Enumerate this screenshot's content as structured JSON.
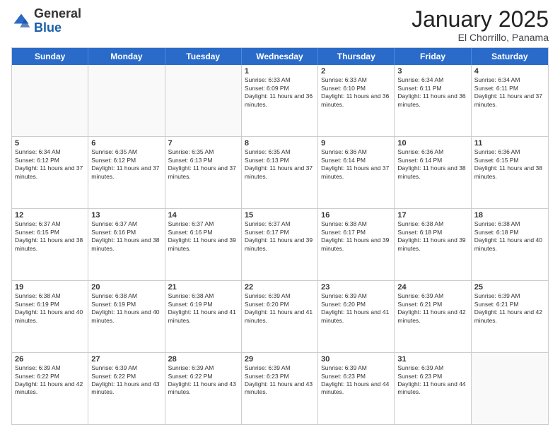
{
  "header": {
    "logo_general": "General",
    "logo_blue": "Blue",
    "month_title": "January 2025",
    "subtitle": "El Chorrillo, Panama"
  },
  "days_of_week": [
    "Sunday",
    "Monday",
    "Tuesday",
    "Wednesday",
    "Thursday",
    "Friday",
    "Saturday"
  ],
  "rows": [
    [
      {
        "day": "",
        "text": "",
        "empty": true
      },
      {
        "day": "",
        "text": "",
        "empty": true
      },
      {
        "day": "",
        "text": "",
        "empty": true
      },
      {
        "day": "1",
        "text": "Sunrise: 6:33 AM\nSunset: 6:09 PM\nDaylight: 11 hours and 36 minutes.",
        "empty": false
      },
      {
        "day": "2",
        "text": "Sunrise: 6:33 AM\nSunset: 6:10 PM\nDaylight: 11 hours and 36 minutes.",
        "empty": false
      },
      {
        "day": "3",
        "text": "Sunrise: 6:34 AM\nSunset: 6:11 PM\nDaylight: 11 hours and 36 minutes.",
        "empty": false
      },
      {
        "day": "4",
        "text": "Sunrise: 6:34 AM\nSunset: 6:11 PM\nDaylight: 11 hours and 37 minutes.",
        "empty": false
      }
    ],
    [
      {
        "day": "5",
        "text": "Sunrise: 6:34 AM\nSunset: 6:12 PM\nDaylight: 11 hours and 37 minutes.",
        "empty": false
      },
      {
        "day": "6",
        "text": "Sunrise: 6:35 AM\nSunset: 6:12 PM\nDaylight: 11 hours and 37 minutes.",
        "empty": false
      },
      {
        "day": "7",
        "text": "Sunrise: 6:35 AM\nSunset: 6:13 PM\nDaylight: 11 hours and 37 minutes.",
        "empty": false
      },
      {
        "day": "8",
        "text": "Sunrise: 6:35 AM\nSunset: 6:13 PM\nDaylight: 11 hours and 37 minutes.",
        "empty": false
      },
      {
        "day": "9",
        "text": "Sunrise: 6:36 AM\nSunset: 6:14 PM\nDaylight: 11 hours and 37 minutes.",
        "empty": false
      },
      {
        "day": "10",
        "text": "Sunrise: 6:36 AM\nSunset: 6:14 PM\nDaylight: 11 hours and 38 minutes.",
        "empty": false
      },
      {
        "day": "11",
        "text": "Sunrise: 6:36 AM\nSunset: 6:15 PM\nDaylight: 11 hours and 38 minutes.",
        "empty": false
      }
    ],
    [
      {
        "day": "12",
        "text": "Sunrise: 6:37 AM\nSunset: 6:15 PM\nDaylight: 11 hours and 38 minutes.",
        "empty": false
      },
      {
        "day": "13",
        "text": "Sunrise: 6:37 AM\nSunset: 6:16 PM\nDaylight: 11 hours and 38 minutes.",
        "empty": false
      },
      {
        "day": "14",
        "text": "Sunrise: 6:37 AM\nSunset: 6:16 PM\nDaylight: 11 hours and 39 minutes.",
        "empty": false
      },
      {
        "day": "15",
        "text": "Sunrise: 6:37 AM\nSunset: 6:17 PM\nDaylight: 11 hours and 39 minutes.",
        "empty": false
      },
      {
        "day": "16",
        "text": "Sunrise: 6:38 AM\nSunset: 6:17 PM\nDaylight: 11 hours and 39 minutes.",
        "empty": false
      },
      {
        "day": "17",
        "text": "Sunrise: 6:38 AM\nSunset: 6:18 PM\nDaylight: 11 hours and 39 minutes.",
        "empty": false
      },
      {
        "day": "18",
        "text": "Sunrise: 6:38 AM\nSunset: 6:18 PM\nDaylight: 11 hours and 40 minutes.",
        "empty": false
      }
    ],
    [
      {
        "day": "19",
        "text": "Sunrise: 6:38 AM\nSunset: 6:19 PM\nDaylight: 11 hours and 40 minutes.",
        "empty": false
      },
      {
        "day": "20",
        "text": "Sunrise: 6:38 AM\nSunset: 6:19 PM\nDaylight: 11 hours and 40 minutes.",
        "empty": false
      },
      {
        "day": "21",
        "text": "Sunrise: 6:38 AM\nSunset: 6:19 PM\nDaylight: 11 hours and 41 minutes.",
        "empty": false
      },
      {
        "day": "22",
        "text": "Sunrise: 6:39 AM\nSunset: 6:20 PM\nDaylight: 11 hours and 41 minutes.",
        "empty": false
      },
      {
        "day": "23",
        "text": "Sunrise: 6:39 AM\nSunset: 6:20 PM\nDaylight: 11 hours and 41 minutes.",
        "empty": false
      },
      {
        "day": "24",
        "text": "Sunrise: 6:39 AM\nSunset: 6:21 PM\nDaylight: 11 hours and 42 minutes.",
        "empty": false
      },
      {
        "day": "25",
        "text": "Sunrise: 6:39 AM\nSunset: 6:21 PM\nDaylight: 11 hours and 42 minutes.",
        "empty": false
      }
    ],
    [
      {
        "day": "26",
        "text": "Sunrise: 6:39 AM\nSunset: 6:22 PM\nDaylight: 11 hours and 42 minutes.",
        "empty": false
      },
      {
        "day": "27",
        "text": "Sunrise: 6:39 AM\nSunset: 6:22 PM\nDaylight: 11 hours and 43 minutes.",
        "empty": false
      },
      {
        "day": "28",
        "text": "Sunrise: 6:39 AM\nSunset: 6:22 PM\nDaylight: 11 hours and 43 minutes.",
        "empty": false
      },
      {
        "day": "29",
        "text": "Sunrise: 6:39 AM\nSunset: 6:23 PM\nDaylight: 11 hours and 43 minutes.",
        "empty": false
      },
      {
        "day": "30",
        "text": "Sunrise: 6:39 AM\nSunset: 6:23 PM\nDaylight: 11 hours and 44 minutes.",
        "empty": false
      },
      {
        "day": "31",
        "text": "Sunrise: 6:39 AM\nSunset: 6:23 PM\nDaylight: 11 hours and 44 minutes.",
        "empty": false
      },
      {
        "day": "",
        "text": "",
        "empty": true
      }
    ]
  ]
}
